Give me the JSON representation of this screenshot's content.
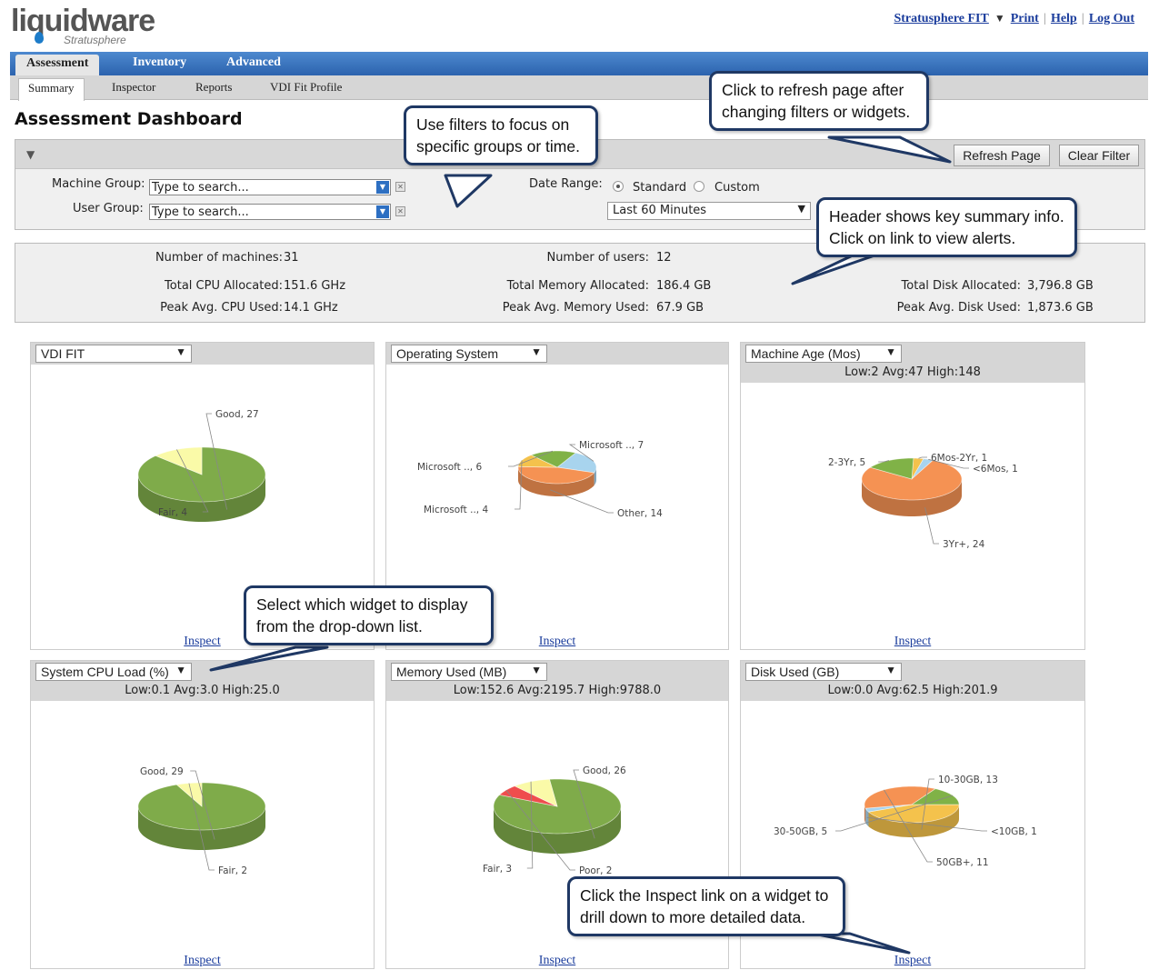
{
  "header": {
    "logo_main": "liquidware",
    "logo_sub": "Stratusphere",
    "links": [
      "Stratusphere FIT",
      "Print",
      "Help",
      "Log Out"
    ]
  },
  "nav": {
    "tabs": [
      "Assessment",
      "Inventory",
      "Advanced"
    ],
    "subtabs": [
      "Summary",
      "Inspector",
      "Reports",
      "VDI Fit Profile"
    ]
  },
  "page_title": "Assessment Dashboard",
  "filters": {
    "toggle": "▼",
    "machine_group_label": "Machine Group:",
    "machine_group_placeholder": "Type to search...",
    "user_group_label": "User Group:",
    "user_group_placeholder": "Type to search...",
    "date_range_label": "Date Range:",
    "date_standard": "Standard",
    "date_custom": "Custom",
    "date_value": "Last 60 Minutes",
    "refresh_button": "Refresh Page",
    "clear_button": "Clear Filter"
  },
  "summary": {
    "machines_label": "Number of machines:",
    "machines": "31",
    "users_label": "Number of users:",
    "users": "12",
    "cpu_alloc_label": "Total CPU Allocated:",
    "cpu_alloc": "151.6 GHz",
    "cpu_used_label": "Peak Avg. CPU Used:",
    "cpu_used": "14.1 GHz",
    "mem_alloc_label": "Total Memory Allocated:",
    "mem_alloc": "186.4 GB",
    "mem_used_label": "Peak Avg. Memory Used:",
    "mem_used": "67.9 GB",
    "disk_alloc_label": "Total Disk Allocated:",
    "disk_alloc": "3,796.8 GB",
    "disk_used_label": "Peak Avg. Disk Used:",
    "disk_used": "1,873.6 GB"
  },
  "widgets": [
    {
      "select": "VDI FIT",
      "stats": "",
      "inspect": "Inspect"
    },
    {
      "select": "Operating System",
      "stats": "",
      "inspect": "Inspect"
    },
    {
      "select": "Machine Age (Mos)",
      "stats": "Low:2 Avg:47 High:148",
      "inspect": "Inspect"
    },
    {
      "select": "System CPU Load (%)",
      "stats": "Low:0.1 Avg:3.0 High:25.0",
      "inspect": "Inspect"
    },
    {
      "select": "Memory Used (MB)",
      "stats": "Low:152.6 Avg:2195.7 High:9788.0",
      "inspect": "Inspect"
    },
    {
      "select": "Disk Used (GB)",
      "stats": "Low:0.0 Avg:62.5 High:201.9",
      "inspect": "Inspect"
    }
  ],
  "chart_data": [
    {
      "type": "pie",
      "categories": [
        "Good",
        "Fair"
      ],
      "values": [
        27,
        4
      ],
      "labels": [
        "Good, 27",
        "Fair, 4"
      ]
    },
    {
      "type": "pie",
      "categories": [
        "Microsoft ...",
        "Other",
        "Microsoft ...",
        "Microsoft ..."
      ],
      "values": [
        7,
        14,
        4,
        6
      ],
      "labels": [
        "Microsoft .., 7",
        "Other, 14",
        "Microsoft .., 4",
        "Microsoft .., 6"
      ]
    },
    {
      "type": "pie",
      "categories": [
        "6Mos-2Yr",
        "<6Mos",
        "3Yr+",
        "2-3Yr"
      ],
      "values": [
        1,
        1,
        24,
        5
      ],
      "labels": [
        "6Mos-2Yr, 1",
        "<6Mos, 1",
        "3Yr+, 24",
        "2-3Yr, 5"
      ]
    },
    {
      "type": "pie",
      "categories": [
        "Good",
        "Fair"
      ],
      "values": [
        29,
        2
      ],
      "labels": [
        "Good, 29",
        "Fair, 2"
      ]
    },
    {
      "type": "pie",
      "categories": [
        "Good",
        "Poor",
        "Fair"
      ],
      "values": [
        26,
        2,
        3
      ],
      "labels": [
        "Good, 26",
        "Poor, 2",
        "Fair, 3"
      ]
    },
    {
      "type": "pie",
      "categories": [
        "10-30GB",
        "<10GB",
        "50GB+",
        "30-50GB"
      ],
      "values": [
        13,
        1,
        11,
        5
      ],
      "labels": [
        "10-30GB, 13",
        "<10GB, 1",
        "50GB+, 11",
        "30-50GB, 5"
      ]
    }
  ],
  "callouts": {
    "filters": "Use filters to focus on specific groups or time.",
    "refresh": "Click to refresh page after changing filters or widgets.",
    "header": "Header shows key summary info. Click on link to view alerts.",
    "widget": "Select which widget to display from the drop-down list.",
    "inspect": "Click the Inspect link on a widget to drill down to more detailed data."
  }
}
